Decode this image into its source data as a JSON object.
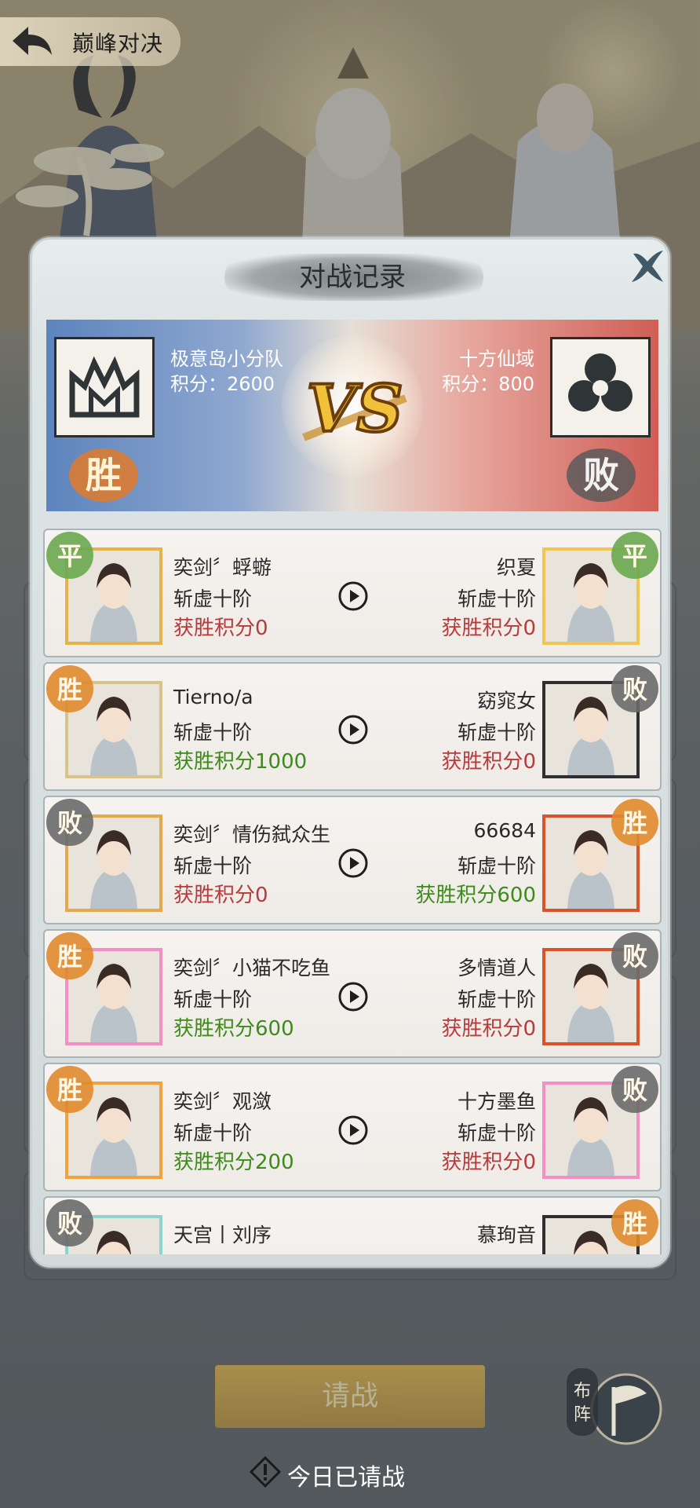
{
  "header": {
    "title": "巅峰对决"
  },
  "dialog": {
    "title": "对战记录",
    "left_team": {
      "name": "极意岛小分队",
      "score_label": "积分：2600",
      "result": "胜"
    },
    "right_team": {
      "name": "十方仙域",
      "score_label": "积分：800",
      "result": "败"
    },
    "vs_text": "VS"
  },
  "records": [
    {
      "left": {
        "name": "奕剑〞蜉蝣",
        "rank": "斩虚十阶",
        "points": "获胜积分0",
        "result": "平",
        "outcome": "lose"
      },
      "right": {
        "name": "织夏",
        "rank": "斩虚十阶",
        "points": "获胜积分0",
        "result": "平",
        "outcome": "lose"
      }
    },
    {
      "left": {
        "name": "Tierno/a",
        "rank": "斩虚十阶",
        "points": "获胜积分1000",
        "result": "胜",
        "outcome": "win"
      },
      "right": {
        "name": "窈窕女",
        "rank": "斩虚十阶",
        "points": "获胜积分0",
        "result": "败",
        "outcome": "lose"
      }
    },
    {
      "left": {
        "name": "奕剑〞情伤弑众生",
        "rank": "斩虚十阶",
        "points": "获胜积分0",
        "result": "败",
        "outcome": "lose"
      },
      "right": {
        "name": "66684",
        "rank": "斩虚十阶",
        "points": "获胜积分600",
        "result": "胜",
        "outcome": "win"
      }
    },
    {
      "left": {
        "name": "奕剑〞小猫不吃鱼",
        "rank": "斩虚十阶",
        "points": "获胜积分600",
        "result": "胜",
        "outcome": "win"
      },
      "right": {
        "name": "多情道人",
        "rank": "斩虚十阶",
        "points": "获胜积分0",
        "result": "败",
        "outcome": "lose"
      }
    },
    {
      "left": {
        "name": "奕剑〞观潋",
        "rank": "斩虚十阶",
        "points": "获胜积分200",
        "result": "胜",
        "outcome": "win"
      },
      "right": {
        "name": "十方墨鱼",
        "rank": "斩虚十阶",
        "points": "获胜积分0",
        "result": "败",
        "outcome": "lose"
      }
    },
    {
      "left": {
        "name": "天宫丨刘序",
        "rank": "",
        "points": "",
        "result": "败",
        "outcome": "lose"
      },
      "right": {
        "name": "慕珣音",
        "rank": "",
        "points": "",
        "result": "胜",
        "outcome": "win"
      }
    }
  ],
  "footer": {
    "challenge_label": "请战",
    "formation_label": "布阵",
    "daily_note": "今日已请战"
  },
  "colors": {
    "win_points": "#3f8a1c",
    "lose_points": "#b43c3c",
    "banner_left": "#5d84bd",
    "banner_right": "#d05e55",
    "challenge_button": "#b8953f"
  }
}
